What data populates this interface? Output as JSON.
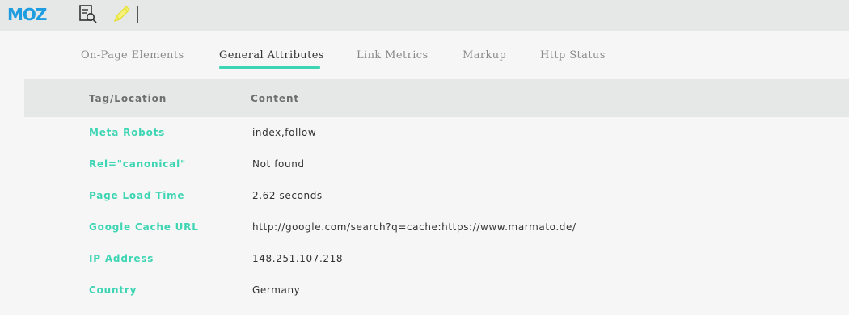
{
  "toolbar": {
    "logo_text": "MOZ",
    "page_analysis_icon": "page-search-icon",
    "highlight_icon": "pencil-icon"
  },
  "tabs": [
    {
      "label": "On-Page Elements",
      "active": false
    },
    {
      "label": "General Attributes",
      "active": true
    },
    {
      "label": "Link Metrics",
      "active": false
    },
    {
      "label": "Markup",
      "active": false
    },
    {
      "label": "Http Status",
      "active": false
    }
  ],
  "table": {
    "headers": [
      "Tag/Location",
      "Content"
    ],
    "rows": [
      {
        "key": "Meta Robots",
        "value": "index,follow"
      },
      {
        "key": "Rel=\"canonical\"",
        "value": "Not found"
      },
      {
        "key": "Page Load Time",
        "value": "2.62 seconds"
      },
      {
        "key": "Google Cache URL",
        "value": "http://google.com/search?q=cache:https://www.marmato.de/"
      },
      {
        "key": "IP Address",
        "value": "148.251.107.218"
      },
      {
        "key": "Country",
        "value": "Germany"
      }
    ]
  },
  "colors": {
    "accent": "#3dd5b3",
    "brand_blue": "#1e9ee0",
    "toolbar_bg": "#e6e7e7",
    "panel_bg": "#f6f6f6"
  }
}
